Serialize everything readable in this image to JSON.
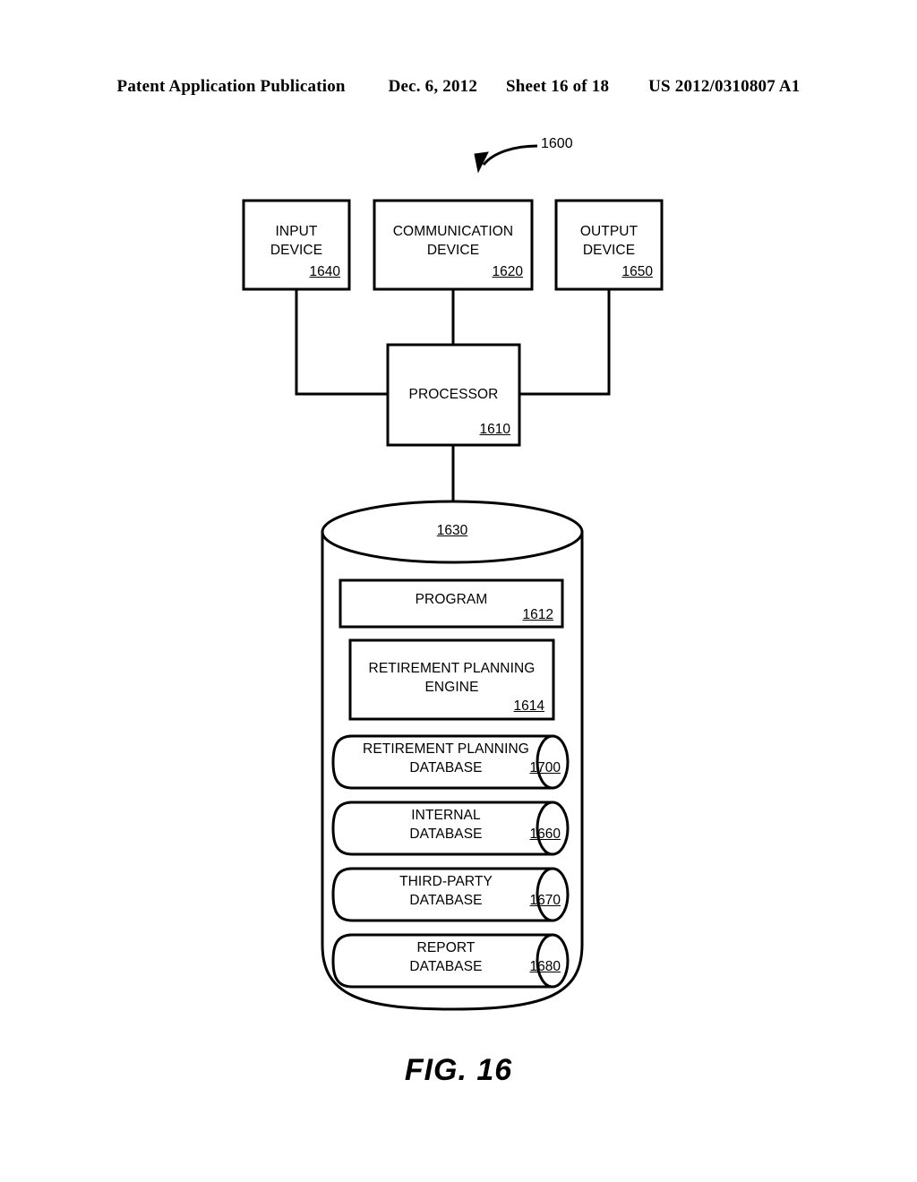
{
  "header": {
    "publication": "Patent Application Publication",
    "date": "Dec. 6, 2012",
    "sheet": "Sheet 16 of 18",
    "patent_number": "US 2012/0310807 A1"
  },
  "figure": {
    "caption": "FIG. 16",
    "system_ref": "1600",
    "line_color": "#000000",
    "fill_color": "#ffffff"
  },
  "nodes": {
    "input_device": {
      "line1": "INPUT",
      "line2": "DEVICE",
      "ref": "1640"
    },
    "communication_device": {
      "line1": "COMMUNICATION",
      "line2": "DEVICE",
      "ref": "1620"
    },
    "output_device": {
      "line1": "OUTPUT",
      "line2": "DEVICE",
      "ref": "1650"
    },
    "processor": {
      "line1": "PROCESSOR",
      "ref": "1610"
    },
    "storage": {
      "ref": "1630"
    },
    "program": {
      "line1": "PROGRAM",
      "ref": "1612"
    },
    "retirement_planning_engine": {
      "line1": "RETIREMENT PLANNING",
      "line2": "ENGINE",
      "ref": "1614"
    },
    "retirement_planning_database": {
      "line1": "RETIREMENT PLANNING",
      "line2": "DATABASE",
      "ref": "1700"
    },
    "internal_database": {
      "line1": "INTERNAL",
      "line2": "DATABASE",
      "ref": "1660"
    },
    "third_party_database": {
      "line1": "THIRD-PARTY",
      "line2": "DATABASE",
      "ref": "1670"
    },
    "report_database": {
      "line1": "REPORT",
      "line2": "DATABASE",
      "ref": "1680"
    }
  }
}
